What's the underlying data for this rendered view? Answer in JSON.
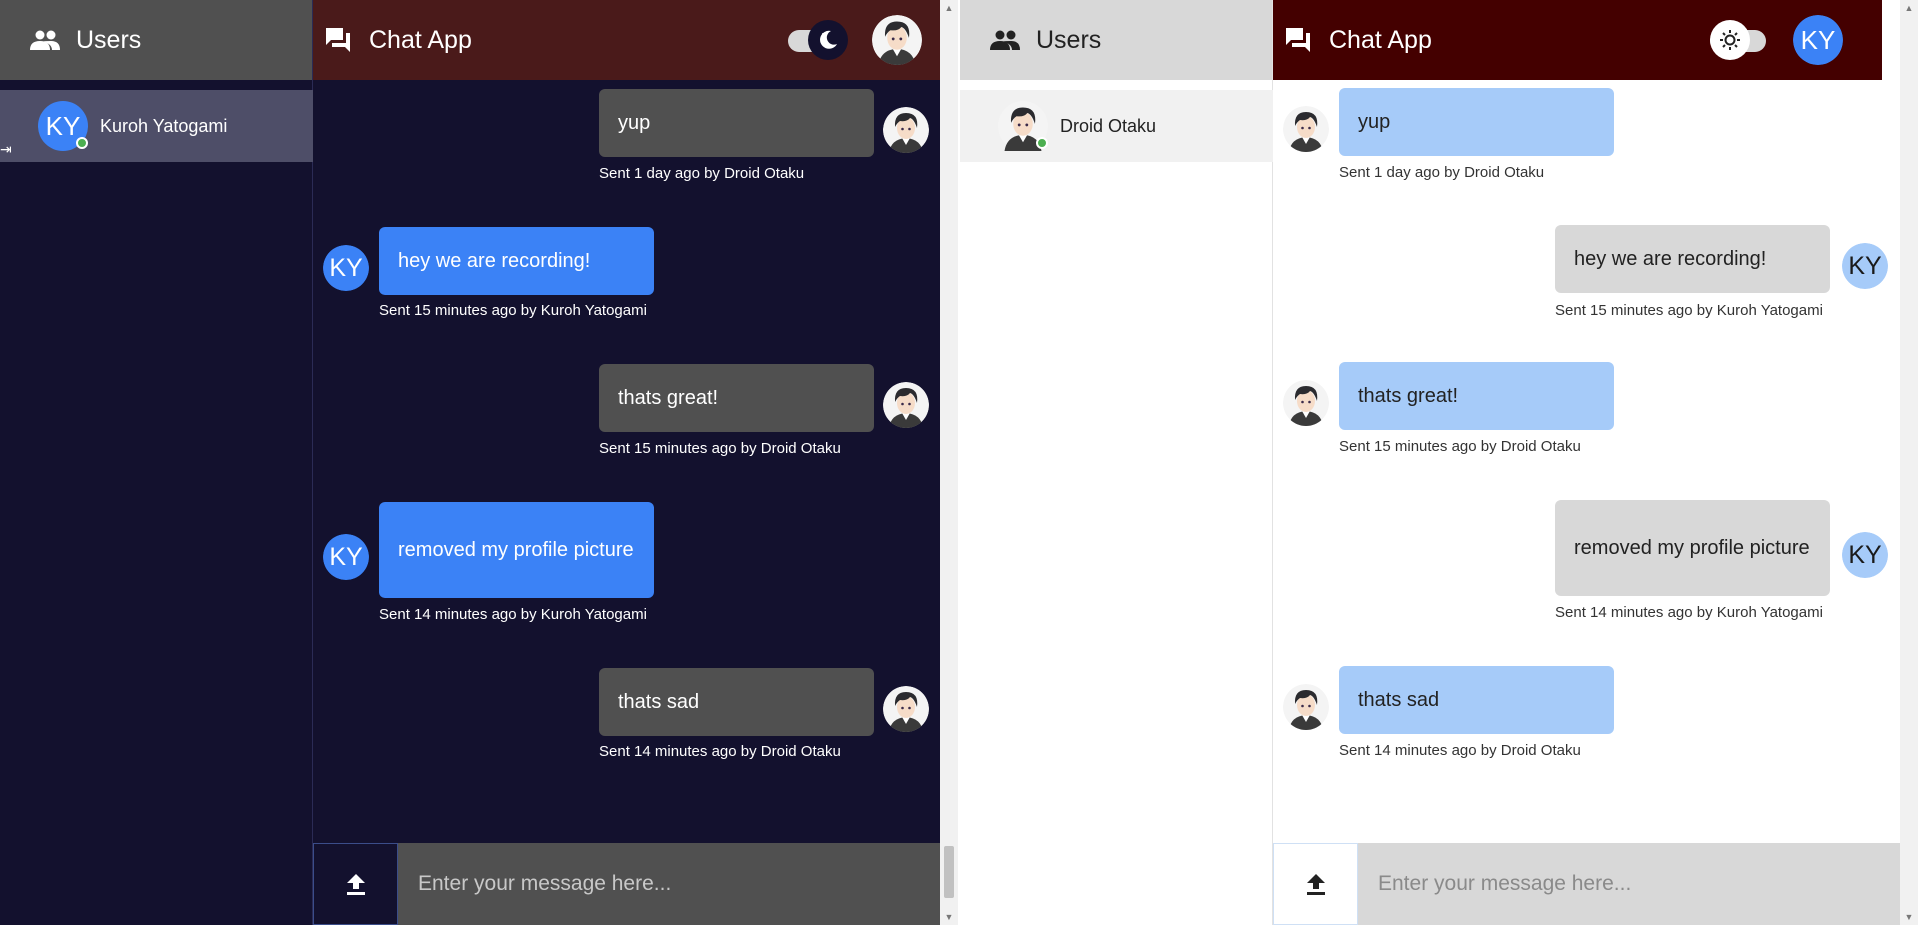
{
  "colors": {
    "dark_bg": "#13112e",
    "dark_header": "#4a1a1a",
    "light_header": "#440000",
    "sent_blue": "#3b82f6",
    "light_blue": "#a6cbf9",
    "dark_gray": "#505050",
    "light_gray": "#d8d8d8",
    "online": "#4caf50"
  },
  "left": {
    "sidebar": {
      "title": "Users",
      "icon": "users-icon",
      "user": {
        "name": "Kuroh Yatogami",
        "initials": "KY"
      }
    },
    "header": {
      "title": "Chat App",
      "icon": "chat-icon",
      "theme": "dark"
    },
    "messages": [
      {
        "text": "yup",
        "caption": "Sent 1 day ago by Droid Otaku"
      },
      {
        "text": "hey we are recording!",
        "caption": "Sent 15 minutes ago by Kuroh Yatogami",
        "initials": "KY"
      },
      {
        "text": "thats great!",
        "caption": "Sent 15 minutes ago by Droid Otaku"
      },
      {
        "text": "removed my profile picture",
        "caption": "Sent 14 minutes ago by Kuroh Yatogami",
        "initials": "KY"
      },
      {
        "text": "thats sad",
        "caption": "Sent 14 minutes ago by Droid Otaku"
      }
    ],
    "composer": {
      "placeholder": "Enter your message here..."
    }
  },
  "right": {
    "sidebar": {
      "title": "Users",
      "icon": "users-icon",
      "user": {
        "name": "Droid Otaku"
      }
    },
    "header": {
      "title": "Chat App",
      "icon": "chat-icon",
      "theme": "light",
      "avatar_initials": "KY"
    },
    "messages": [
      {
        "text": "yup",
        "caption": "Sent 1 day ago by Droid Otaku"
      },
      {
        "text": "hey we are recording!",
        "caption": "Sent 15 minutes ago by Kuroh Yatogami",
        "initials": "KY"
      },
      {
        "text": "thats great!",
        "caption": "Sent 15 minutes ago by Droid Otaku"
      },
      {
        "text": "removed my profile picture",
        "caption": "Sent 14 minutes ago by Kuroh Yatogami",
        "initials": "KY"
      },
      {
        "text": "thats sad",
        "caption": "Sent 14 minutes ago by Droid Otaku"
      }
    ],
    "composer": {
      "placeholder": "Enter your message here..."
    }
  }
}
